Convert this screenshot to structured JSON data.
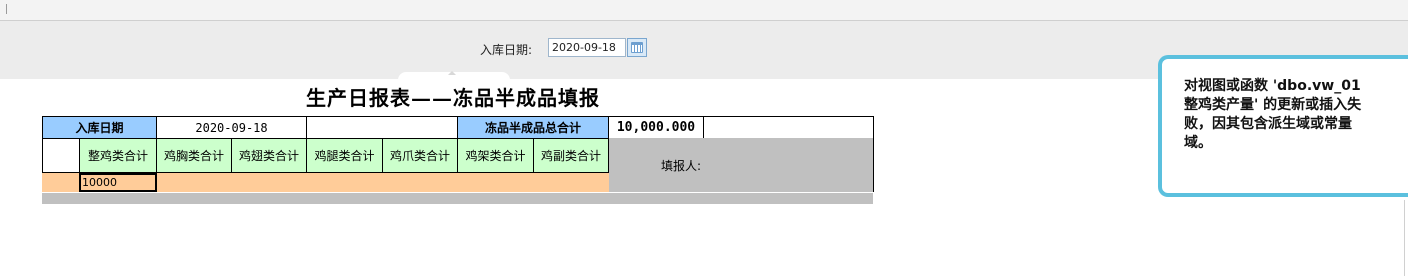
{
  "filter": {
    "date_label": "入库日期:",
    "date_value": "2020-09-18"
  },
  "report": {
    "title": "生产日报表——冻品半成品填报",
    "row1": {
      "date_label": "入库日期",
      "date_value": "2020-09-18",
      "total_label": "冻品半成品总合计",
      "total_value": "10,000.000"
    },
    "columns": [
      "整鸡类合计",
      "鸡胸类合计",
      "鸡翅类合计",
      "鸡腿类合计",
      "鸡爪类合计",
      "鸡架类合计",
      "鸡副类合计"
    ],
    "filler_label": "填报人:",
    "input_value": "10000"
  },
  "tooltip": {
    "message": "对视图或函数 'dbo.vw_01整鸡类产量' 的更新或插入失败，因其包含派生域或常量域。"
  },
  "colors": {
    "header_blue": "#99ccff",
    "column_green": "#ccffcc",
    "input_peach": "#ffcc99",
    "filler_gray": "#c0c0c0",
    "tooltip_border": "#5bc0de"
  }
}
